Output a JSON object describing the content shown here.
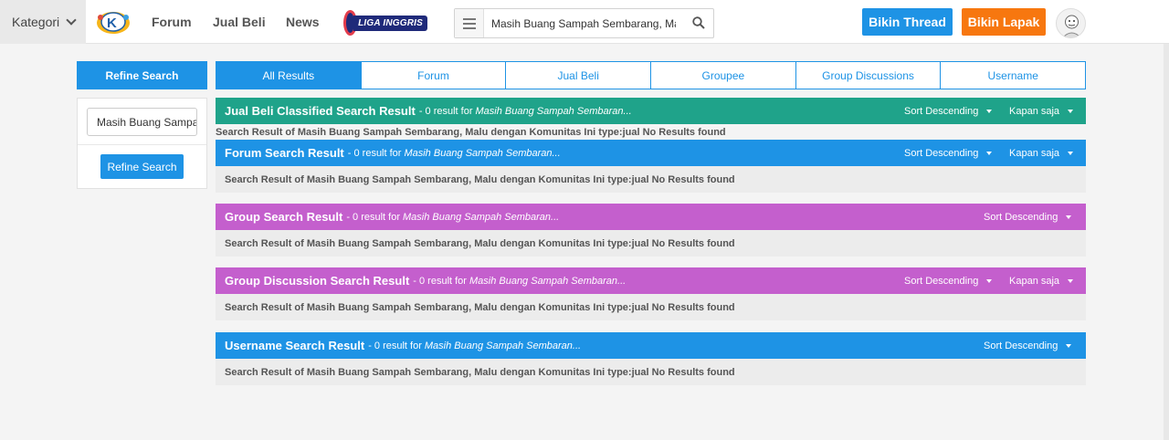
{
  "topbar": {
    "kategori_label": "Kategori",
    "nav": [
      "Forum",
      "Jual Beli",
      "News"
    ],
    "liga_badge": "",
    "liga_label": "LIGA INGGRIS",
    "search_value": "Masih Buang Sampah Sembarang, Malu dengan Komunitas Ini",
    "bikin_thread": "Bikin Thread",
    "bikin_lapak": "Bikin Lapak"
  },
  "sidebar": {
    "header": "Refine Search",
    "input_value": "Masih Buang Sampah Sembarang, Malu dengan Komunitas Ini",
    "button": "Refine Search"
  },
  "tabs": [
    "All Results",
    "Forum",
    "Jual Beli",
    "Groupee",
    "Group Discussions",
    "Username"
  ],
  "sections": {
    "jual_beli": {
      "title": "Jual Beli Classified Search Result",
      "meta": "- 0 result for",
      "query": "Masih Buang Sampah Sembaran...",
      "sort": "Sort Descending",
      "time": "Kapan saja",
      "message": "Search Result of Masih Buang Sampah Sembarang, Malu dengan Komunitas Ini type:jual No Results found"
    },
    "forum": {
      "title": "Forum Search Result",
      "meta": "- 0 result for",
      "query": "Masih Buang Sampah Sembaran...",
      "sort": "Sort Descending",
      "time": "Kapan saja",
      "message": "Search Result of Masih Buang Sampah Sembarang, Malu dengan Komunitas Ini type:jual No Results found"
    },
    "group": {
      "title": "Group Search Result",
      "meta": "- 0 result for",
      "query": "Masih Buang Sampah Sembaran...",
      "sort": "Sort Descending",
      "message": "Search Result of Masih Buang Sampah Sembarang, Malu dengan Komunitas Ini type:jual No Results found"
    },
    "group_discussion": {
      "title": "Group Discussion Search Result",
      "meta": "- 0 result for",
      "query": "Masih Buang Sampah Sembaran...",
      "sort": "Sort Descending",
      "time": "Kapan saja",
      "message": "Search Result of Masih Buang Sampah Sembarang, Malu dengan Komunitas Ini type:jual No Results found"
    },
    "username": {
      "title": "Username Search Result",
      "meta": "- 0 result for",
      "query": "Masih Buang Sampah Sembaran...",
      "sort": "Sort Descending",
      "message": "Search Result of Masih Buang Sampah Sembarang, Malu dengan Komunitas Ini type:jual No Results found"
    }
  },
  "colors": {
    "primary_blue": "#1e93e5",
    "teal": "#1fa38a",
    "purple": "#c45fcd",
    "orange": "#f7770f"
  }
}
